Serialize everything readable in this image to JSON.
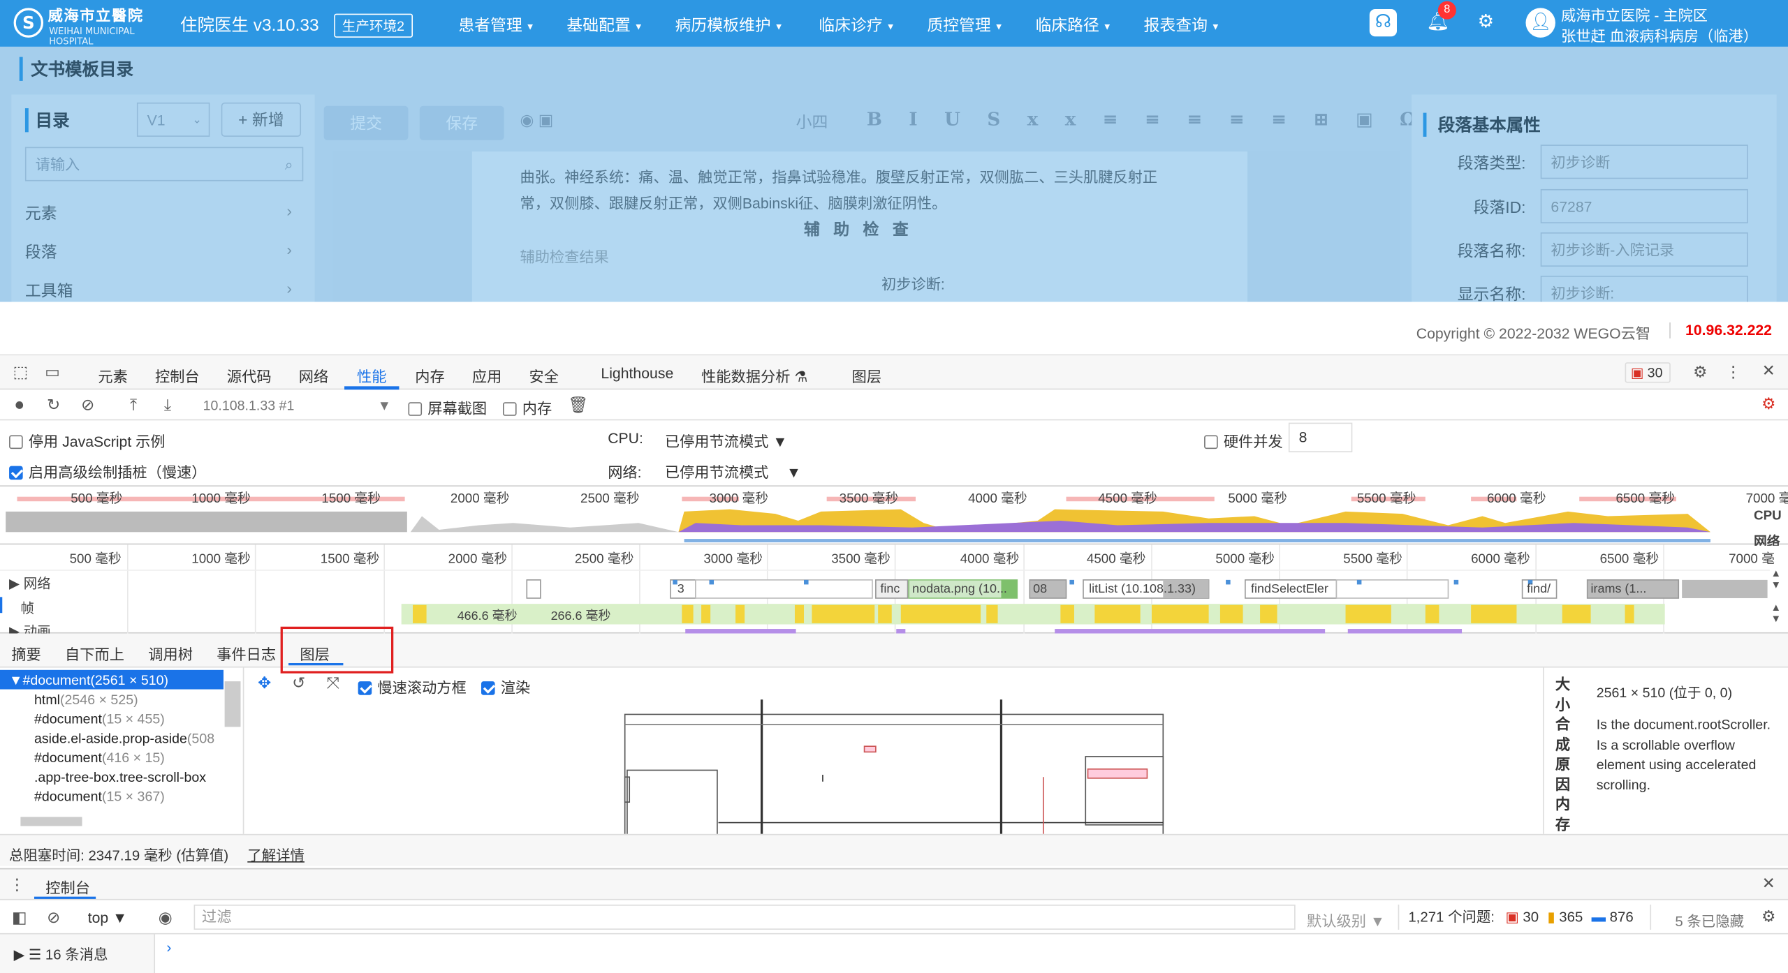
{
  "app": {
    "logo_text": "威海市立醫院",
    "logo_sub": "WEIHAI MUNICIPAL HOSPITAL",
    "version": "住院医生 v3.10.33",
    "env": "生产环境2",
    "menus": [
      "患者管理",
      "基础配置",
      "病历模板维护",
      "临床诊疗",
      "质控管理",
      "临床路径",
      "报表查询"
    ],
    "notif_count": "8",
    "user_line1": "威海市立医院 - 主院区",
    "user_line2": "张世赶  血液病科病房（临港）"
  },
  "page": {
    "title": "文书模板目录",
    "catalog_label": "目录",
    "version_select": "V1",
    "add_label": "+ 新增",
    "search_placeholder": "请输入",
    "tree": [
      "元素",
      "段落",
      "工具箱"
    ],
    "submit_label": "提交",
    "save_label": "保存",
    "font_size": "小四",
    "editor_lines": [
      "曲张。神经系统：痛、温、触觉正常，指鼻试验稳准。腹壁反射正常，双侧肱二、三头肌腱反射正",
      "常，双侧膝、跟腱反射正常，双侧Babinski征、脑膜刺激征阴性。",
      "辅 助 检 查",
      "辅助检查结果",
      "初步诊断:"
    ],
    "props_title": "段落基本属性",
    "props": [
      {
        "label": "段落类型:",
        "value": "初步诊断"
      },
      {
        "label": "段落ID:",
        "value": "67287"
      },
      {
        "label": "段落名称:",
        "value": "初步诊断-入院记录"
      },
      {
        "label": "显示名称:",
        "value": "初步诊断:"
      }
    ],
    "copyright": "Copyright © 2022-2032 WEGO云智",
    "ip": "10.96.32.222"
  },
  "devtools": {
    "tabs": [
      "元素",
      "控制台",
      "源代码",
      "网络",
      "性能",
      "内存",
      "应用",
      "安全",
      "Lighthouse",
      "性能数据分析 ⚗",
      "图层"
    ],
    "active_tab": "性能",
    "error_count": "30",
    "profile_name": "10.108.1.33 #1",
    "screenshot_label": "屏幕截图",
    "memory_label": "内存",
    "disable_js": "停用 JavaScript 示例",
    "advanced_paint": "启用高级绘制插桩（慢速）",
    "cpu_label": "CPU:",
    "cpu_value": "已停用节流模式",
    "net_label": "网络:",
    "net_value": "已停用节流模式",
    "hw_label": "硬件并发",
    "hw_value": "8",
    "overview_ticks": [
      "500 毫秒",
      "1000 毫秒",
      "1500 毫秒",
      "2000 毫秒",
      "2500 毫秒",
      "3000 毫秒",
      "3500 毫秒",
      "4000 毫秒",
      "4500 毫秒",
      "5000 毫秒",
      "5500 毫秒",
      "6000 毫秒",
      "6500 毫秒",
      "7000 毫"
    ],
    "cpu_tag": "CPU",
    "net_tag": "网络",
    "tracks": [
      "网络",
      "帧",
      "动画"
    ],
    "net_requests": [
      "3",
      "finc",
      "nodata.png (10...",
      "08",
      "litList (10.108.1.33)",
      "findSelectEler",
      "find/",
      "irams (1..."
    ],
    "frame_labels": [
      "466.6 毫秒",
      "266.6 毫秒"
    ],
    "bottom_tabs": [
      "摘要",
      "自下而上",
      "调用树",
      "事件日志",
      "图层"
    ],
    "layers": [
      {
        "name": "▼#document",
        "dim": "(2561 × 510)"
      },
      {
        "name": "html",
        "dim": "(2546 × 525)"
      },
      {
        "name": "#document",
        "dim": "(15 × 455)"
      },
      {
        "name": "aside.el-aside.prop-aside",
        "dim": "(508"
      },
      {
        "name": "#document",
        "dim": "(416 × 15)"
      },
      {
        "name": ".app-tree-box.tree-scroll-box",
        "dim": ""
      },
      {
        "name": "#document",
        "dim": "(15 × 367)"
      }
    ],
    "slow_scroll": "慢速滚动方框",
    "paint": "渲染",
    "side_heading": "大小合成原因内存",
    "layer_size": "2561 × 510 (位于 0, 0)",
    "layer_reason": "Is the document.rootScroller. Is a scrollable overflow element using accelerated scrolling.",
    "blocking": "总阻塞时间: 2347.19 毫秒 (估算值)",
    "learn_more": "了解详情",
    "console_title": "控制台",
    "top_ctx": "top",
    "filter_placeholder": "过滤",
    "levels": "默认级别",
    "issues_label": "1,271 个问题:",
    "issue_err": "30",
    "issue_warn": "365",
    "issue_info": "876",
    "hidden": "5 条已隐藏",
    "messages": "16 条消息"
  }
}
